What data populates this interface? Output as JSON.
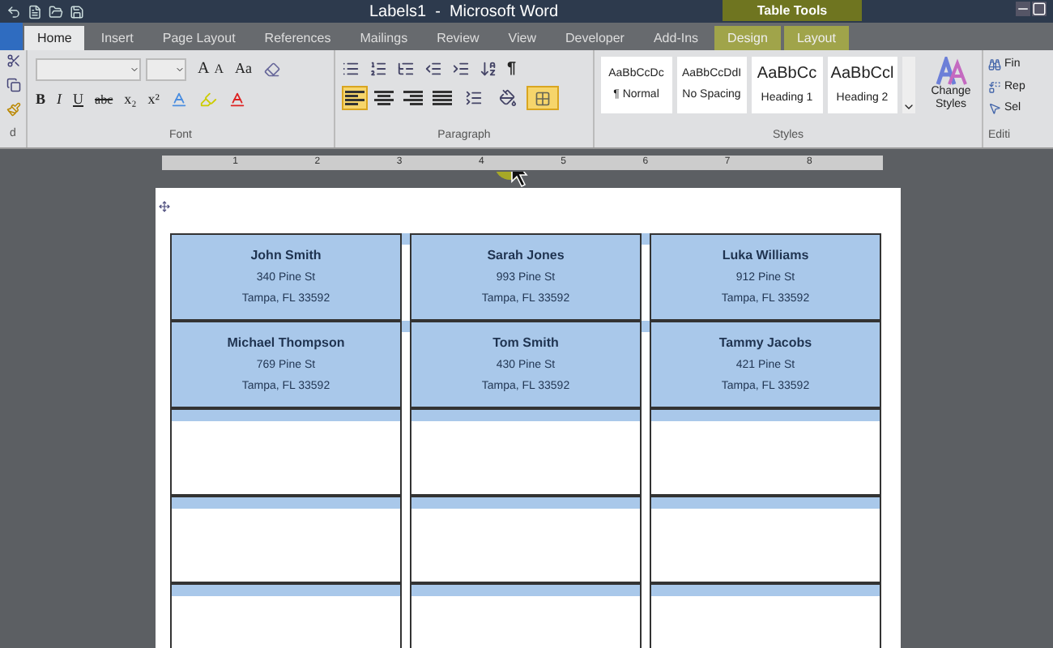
{
  "window": {
    "title": "Labels1  -  Microsoft Word",
    "context_tab": "Table Tools"
  },
  "tabs": [
    {
      "label": "Home",
      "selected": true
    },
    {
      "label": "Insert",
      "selected": false
    },
    {
      "label": "Page Layout",
      "selected": false
    },
    {
      "label": "References",
      "selected": false
    },
    {
      "label": "Mailings",
      "selected": false
    },
    {
      "label": "Review",
      "selected": false
    },
    {
      "label": "View",
      "selected": false
    },
    {
      "label": "Developer",
      "selected": false
    },
    {
      "label": "Add-Ins",
      "selected": false
    },
    {
      "label": "Design",
      "selected": false,
      "contextual": true
    },
    {
      "label": "Layout",
      "selected": false,
      "contextual": true
    }
  ],
  "ribbon": {
    "clipboard": {
      "label": "d"
    },
    "font": {
      "label": "Font",
      "size_buttons": [
        "A",
        "A",
        "Aa"
      ],
      "format_buttons": [
        "B",
        "I",
        "U",
        "abc",
        "x₂",
        "x²"
      ]
    },
    "paragraph": {
      "label": "Paragraph",
      "pilcrow": "¶",
      "alignment": [
        {
          "kind": "left",
          "selected": true
        },
        {
          "kind": "center",
          "selected": false
        },
        {
          "kind": "right",
          "selected": false
        },
        {
          "kind": "justify",
          "selected": false
        }
      ],
      "borders_selected": true
    },
    "styles": {
      "label": "Styles",
      "items": [
        {
          "preview": "AaBbCcDc",
          "name": "¶ Normal",
          "kind": "body"
        },
        {
          "preview": "AaBbCcDdI",
          "name": "No Spacing",
          "kind": "body"
        },
        {
          "preview": "AaBbCc",
          "name": "Heading 1",
          "kind": "heading"
        },
        {
          "preview": "AaBbCcl",
          "name": "Heading 2",
          "kind": "heading"
        }
      ],
      "change_styles": "Change Styles"
    },
    "editing": {
      "label": "Editi",
      "items": [
        "Fin",
        "Rep",
        "Sel"
      ]
    }
  },
  "ruler": {
    "marks": [
      "1",
      "2",
      "3",
      "4",
      "5",
      "6",
      "7",
      "8"
    ]
  },
  "labels": [
    [
      {
        "kind": "address",
        "name": "John Smith",
        "street": "340 Pine St",
        "city": "Tampa, FL 33592"
      },
      {
        "kind": "address",
        "name": "Sarah Jones",
        "street": "993 Pine St",
        "city": "Tampa, FL 33592"
      },
      {
        "kind": "address",
        "name": "Luka Williams",
        "street": "912 Pine St",
        "city": "Tampa, FL 33592"
      }
    ],
    [
      {
        "kind": "address",
        "name": "Michael Thompson",
        "street": "769 Pine St",
        "city": "Tampa, FL 33592"
      },
      {
        "kind": "address",
        "name": "Tom Smith",
        "street": "430 Pine St",
        "city": "Tampa, FL 33592"
      },
      {
        "kind": "address",
        "name": "Tammy Jacobs",
        "street": "421 Pine St",
        "city": "Tampa, FL 33592"
      }
    ],
    [
      {
        "kind": "blank"
      },
      {
        "kind": "blank"
      },
      {
        "kind": "blank"
      }
    ],
    [
      {
        "kind": "blank"
      },
      {
        "kind": "blank"
      },
      {
        "kind": "blank"
      }
    ],
    [
      {
        "kind": "blank"
      },
      {
        "kind": "blank"
      },
      {
        "kind": "blank"
      }
    ]
  ]
}
